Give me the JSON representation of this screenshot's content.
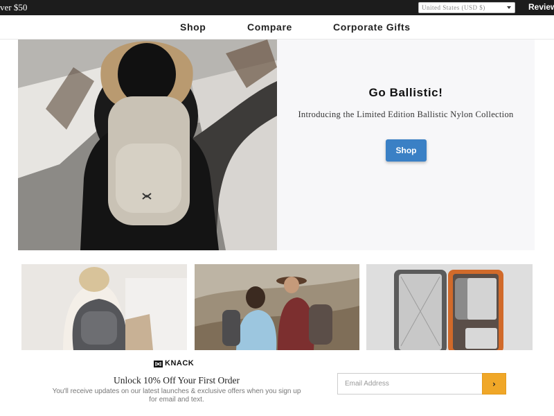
{
  "announcement": {
    "promo_text": "ver $50",
    "currency_value": "United States (USD $)",
    "reviews_label": "Reviews"
  },
  "nav": {
    "items": [
      {
        "label": "Shop"
      },
      {
        "label": "Compare"
      },
      {
        "label": "Corporate Gifts"
      }
    ]
  },
  "hero": {
    "title": "Go Ballistic!",
    "subtitle": "Introducing the Limited Edition Ballistic Nylon Collection",
    "button_label": "Shop"
  },
  "newsletter": {
    "logo_text": "KNACK",
    "title": "Unlock 10% Off Your First Order",
    "subtitle_line1": "You'll receive updates on our latest launches & exclusive offers when you sign up",
    "subtitle_line2": "for email and text.",
    "email_placeholder": "Email Address",
    "submit_icon": "chevron-right-icon"
  },
  "colors": {
    "topbar": "#1c1c1c",
    "accent_button": "#3a80c5",
    "submit_button": "#f0a728"
  }
}
